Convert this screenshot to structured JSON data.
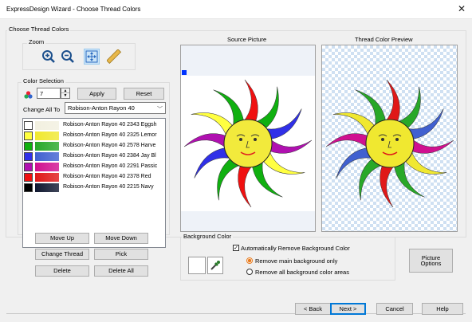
{
  "window": {
    "title": "ExpressDesign Wizard - Choose Thread Colors"
  },
  "section_title": "Choose Thread Colors",
  "zoom": {
    "label": "Zoom",
    "tools": [
      {
        "name": "zoom-in",
        "icon": "zoom-in-icon"
      },
      {
        "name": "zoom-out",
        "icon": "zoom-out-icon"
      },
      {
        "name": "fit",
        "icon": "move-fit-icon"
      },
      {
        "name": "measure",
        "icon": "ruler-icon"
      }
    ]
  },
  "color_selection": {
    "label": "Color Selection",
    "count_value": "7",
    "apply_label": "Apply",
    "reset_label": "Reset",
    "change_all_label": "Change All To",
    "change_all_value": "Robison-Anton Rayon 40",
    "threads": [
      {
        "text": "Robison-Anton Rayon 40 2343 Eggsh",
        "orig": "#ffffff",
        "thread": "#f2f0e0"
      },
      {
        "text": "Robison-Anton Rayon 40 2325 Lemor",
        "orig": "#ffff40",
        "thread": "#f0e830"
      },
      {
        "text": "Robison-Anton Rayon 40 2578 Harve",
        "orig": "#10b010",
        "thread": "#28a828"
      },
      {
        "text": "Robison-Anton Rayon 40 2384 Jay Bl",
        "orig": "#3030e8",
        "thread": "#4060d0"
      },
      {
        "text": "Robison-Anton Rayon 40 2291 Passic",
        "orig": "#b010b0",
        "thread": "#d01090"
      },
      {
        "text": "Robison-Anton Rayon 40 2378 Red",
        "orig": "#f01010",
        "thread": "#e01818"
      },
      {
        "text": "Robison-Anton Rayon 40 2215 Navy",
        "orig": "#000000",
        "thread": "#101830"
      }
    ]
  },
  "buttons": {
    "move_up": "Move Up",
    "move_down": "Move Down",
    "change_thread": "Change Thread",
    "pick": "Pick",
    "delete": "Delete",
    "delete_all": "Delete All",
    "picture_options": "Picture Options",
    "back": "< Back",
    "next": "Next >",
    "cancel": "Cancel",
    "help": "Help"
  },
  "source_picture": {
    "label": "Source Picture"
  },
  "thread_preview": {
    "label": "Thread Color Preview"
  },
  "background": {
    "label": "Background Color",
    "auto_remove_label": "Automatically Remove Background Color",
    "auto_remove_checked": true,
    "radio_main_label": "Remove main background only",
    "radio_all_label": "Remove all background color areas",
    "selected": "main"
  },
  "colors": {
    "accent": "#0078d7",
    "window_bg": "#f0f0f0"
  }
}
